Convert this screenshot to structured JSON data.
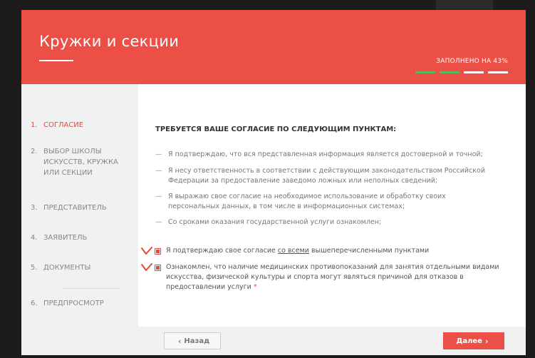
{
  "header": {
    "title": "Кружки и секции",
    "progress_label": "ЗАПОЛНЕНО НА 43%",
    "progress_fraction": 0.43,
    "accent_color": "#ec4f45",
    "progress_color": "#5cb85c"
  },
  "sidebar": {
    "items": [
      {
        "num": "1.",
        "label": "СОГЛАСИЕ"
      },
      {
        "num": "2.",
        "label": "ВЫБОР ШКОЛЫ ИСКУССТВ, КРУЖКА ИЛИ СЕКЦИИ"
      },
      {
        "num": "3.",
        "label": "ПРЕДСТАВИТЕЛЬ"
      },
      {
        "num": "4.",
        "label": "ЗАЯВИТЕЛЬ"
      },
      {
        "num": "5.",
        "label": "ДОКУМЕНТЫ"
      },
      {
        "num": "6.",
        "label": "ПРЕДПРОСМОТР"
      }
    ]
  },
  "main": {
    "heading": "ТРЕБУЕТСЯ ВАШЕ СОГЛАСИЕ ПО СЛЕДУЮЩИМ ПУНКТАМ:",
    "bullets": [
      "Я подтверждаю, что вся представленная информация является достоверной и точной;",
      "Я несу ответственность в соответствии с действующим законодательством Российской Федерации за предоставление заведомо ложных или неполных сведений;",
      "Я выражаю свое согласие на необходимое использование и обработку своих персональных данных, в том числе в информационных системах;",
      "Со сроками оказания государственной услуги ознакомлен;"
    ],
    "consent1": {
      "prefix": "Я подтверждаю свое согласие ",
      "link": "со всеми",
      "suffix": " вышеперечисленными пунктами"
    },
    "consent2": {
      "text": "Ознакомлен, что наличие медицинских противопоказаний для занятия отдельными видами искусства, физической культуры и спорта могут являться причиной для отказов в предоставлении услуги",
      "required_mark": "*"
    }
  },
  "footer": {
    "back_label": "Назад",
    "next_label": "Далее"
  }
}
